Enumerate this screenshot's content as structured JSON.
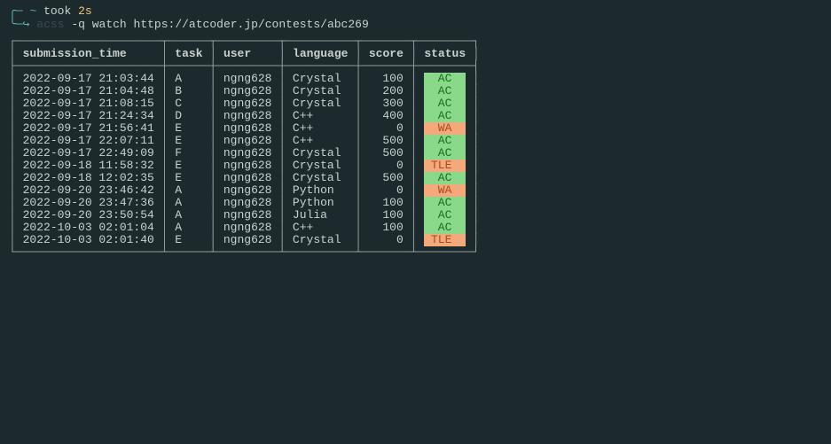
{
  "prompt": {
    "tilde": "~",
    "took": "took",
    "duration": "2s",
    "arrow": "↪",
    "cmd": "acss",
    "args": "-q watch https://atcoder.jp/contests/abc269"
  },
  "headers": {
    "submission_time": "submission_time",
    "task": "task",
    "user": "user",
    "language": "language",
    "score": "score",
    "status": "status"
  },
  "rows": [
    {
      "time": "2022-09-17 21:03:44",
      "task": "A",
      "user": "ngng628",
      "lang": "Crystal",
      "score": "100",
      "status": "AC"
    },
    {
      "time": "2022-09-17 21:04:48",
      "task": "B",
      "user": "ngng628",
      "lang": "Crystal",
      "score": "200",
      "status": "AC"
    },
    {
      "time": "2022-09-17 21:08:15",
      "task": "C",
      "user": "ngng628",
      "lang": "Crystal",
      "score": "300",
      "status": "AC"
    },
    {
      "time": "2022-09-17 21:24:34",
      "task": "D",
      "user": "ngng628",
      "lang": "C++",
      "score": "400",
      "status": "AC"
    },
    {
      "time": "2022-09-17 21:56:41",
      "task": "E",
      "user": "ngng628",
      "lang": "C++",
      "score": "0",
      "status": "WA"
    },
    {
      "time": "2022-09-17 22:07:11",
      "task": "E",
      "user": "ngng628",
      "lang": "C++",
      "score": "500",
      "status": "AC"
    },
    {
      "time": "2022-09-17 22:49:09",
      "task": "F",
      "user": "ngng628",
      "lang": "Crystal",
      "score": "500",
      "status": "AC"
    },
    {
      "time": "2022-09-18 11:58:32",
      "task": "E",
      "user": "ngng628",
      "lang": "Crystal",
      "score": "0",
      "status": "TLE"
    },
    {
      "time": "2022-09-18 12:02:35",
      "task": "E",
      "user": "ngng628",
      "lang": "Crystal",
      "score": "500",
      "status": "AC"
    },
    {
      "time": "2022-09-20 23:46:42",
      "task": "A",
      "user": "ngng628",
      "lang": "Python",
      "score": "0",
      "status": "WA"
    },
    {
      "time": "2022-09-20 23:47:36",
      "task": "A",
      "user": "ngng628",
      "lang": "Python",
      "score": "100",
      "status": "AC"
    },
    {
      "time": "2022-09-20 23:50:54",
      "task": "A",
      "user": "ngng628",
      "lang": "Julia",
      "score": "100",
      "status": "AC"
    },
    {
      "time": "2022-10-03 02:01:04",
      "task": "A",
      "user": "ngng628",
      "lang": "C++",
      "score": "100",
      "status": "AC"
    },
    {
      "time": "2022-10-03 02:01:40",
      "task": "E",
      "user": "ngng628",
      "lang": "Crystal",
      "score": "0",
      "status": "TLE"
    }
  ]
}
